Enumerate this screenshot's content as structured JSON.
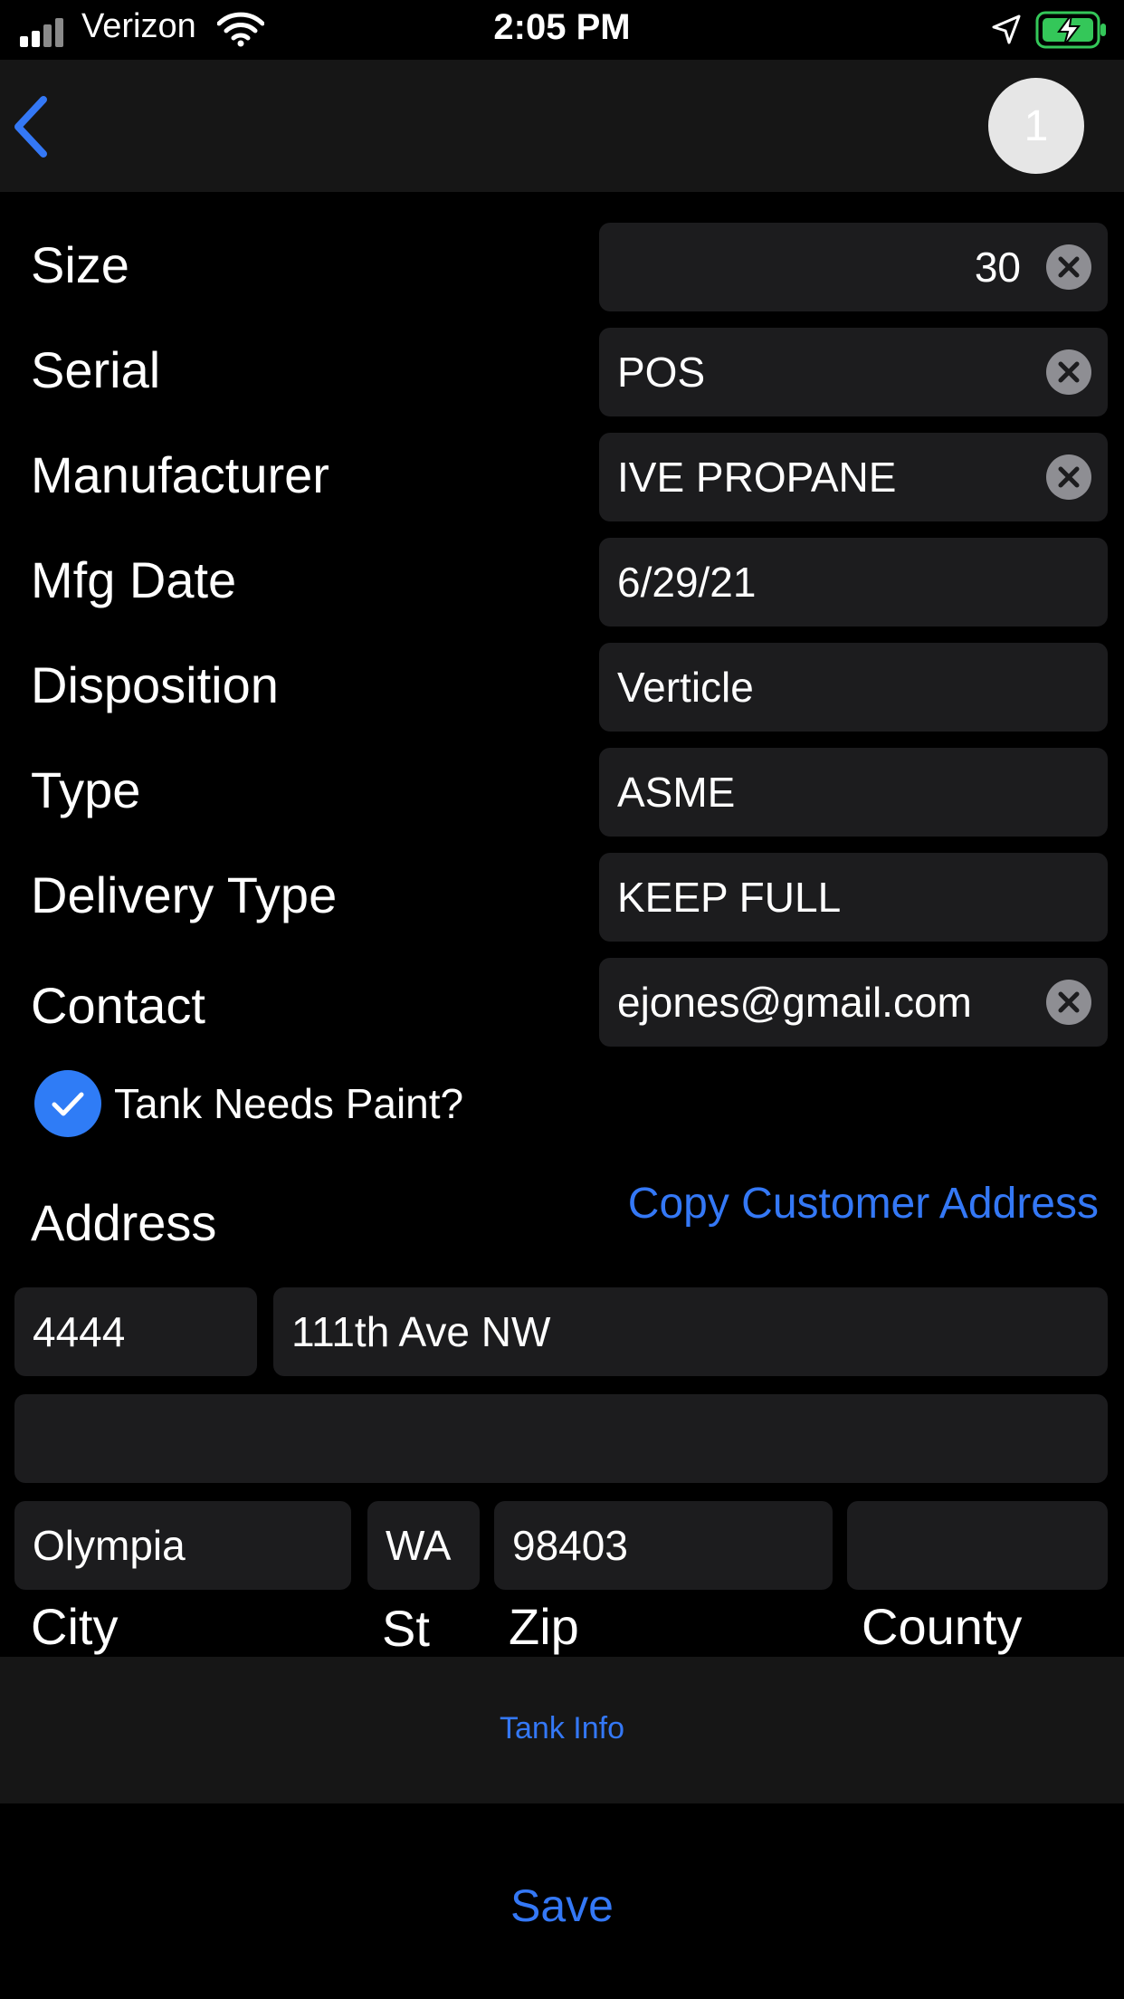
{
  "status_bar": {
    "carrier": "Verizon",
    "time": "2:05 PM"
  },
  "nav": {
    "back_icon": "chevron-left-icon",
    "badge": "1"
  },
  "fields": [
    {
      "label": "Size",
      "value": "30",
      "align": "right",
      "clearable": true
    },
    {
      "label": "Serial",
      "value": "POS",
      "clearable": true
    },
    {
      "label": "Manufacturer",
      "value": "IVE PROPANE",
      "clearable": true
    },
    {
      "label": "Mfg Date",
      "value": "6/29/21",
      "clearable": false
    },
    {
      "label": "Disposition",
      "value": "Verticle",
      "clearable": false
    },
    {
      "label": "Type",
      "value": "ASME",
      "clearable": false
    },
    {
      "label": "Delivery Type",
      "value": "KEEP FULL",
      "clearable": false
    },
    {
      "label": "Contact",
      "value": "ejones@gmail.com",
      "clearable": true
    }
  ],
  "paint_checkbox": {
    "label": "Tank Needs Paint?",
    "checked": true
  },
  "address": {
    "heading": "Address",
    "copy_link": "Copy Customer Address",
    "number": "4444",
    "street": "111th Ave NW",
    "line2": "",
    "city": "Olympia",
    "state": "WA",
    "zip": "98403",
    "county": "",
    "labels": {
      "city": "City",
      "state": "St",
      "zip": "Zip",
      "county": "County"
    }
  },
  "tab_bar": {
    "label": "Tank Info"
  },
  "save_button": "Save",
  "colors": {
    "accent": "#3478f6",
    "field_bg": "#1c1c1e",
    "battery": "#34c759"
  }
}
